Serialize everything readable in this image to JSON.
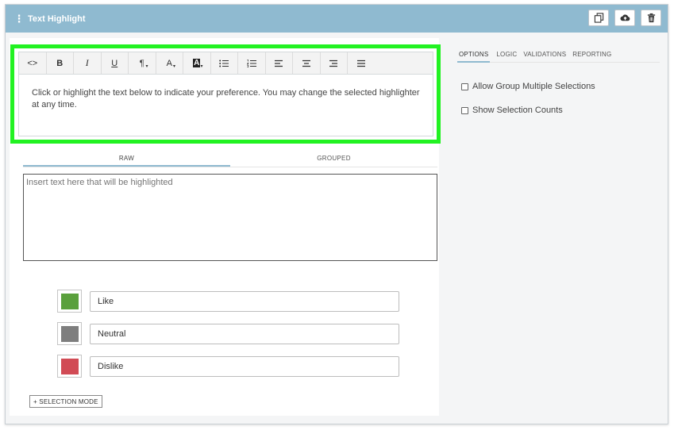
{
  "titlebar": {
    "title": "Text Highlight",
    "drag_glyph": "⋮",
    "actions": [
      "copy-icon",
      "cloud-upload-icon",
      "trash-icon"
    ]
  },
  "editor": {
    "toolbar": {
      "code": "<>",
      "bold": "B",
      "italic": "I",
      "underline": "U",
      "paragraph": "¶",
      "font_color": "A",
      "bg_color": "A",
      "caret": "▾"
    },
    "content": "Click or highlight the text below to indicate your preference. You may change the selected highlighter at any time."
  },
  "text_tabs": [
    "RAW",
    "GROUPED"
  ],
  "textarea": {
    "placeholder": "Insert text here that will be highlighted"
  },
  "highlighters": [
    {
      "label": "Like",
      "color": "#5aa03c"
    },
    {
      "label": "Neutral",
      "color": "#7e7e7e"
    },
    {
      "label": "Dislike",
      "color": "#d14b55"
    }
  ],
  "selection_mode_button": "+ SELECTION MODE",
  "options_panel": {
    "tabs": [
      "OPTIONS",
      "LOGIC",
      "VALIDATIONS",
      "REPORTING"
    ],
    "checkboxes": [
      "Allow Group Multiple Selections",
      "Show Selection Counts"
    ]
  },
  "colors": {
    "header": "#8fbad0",
    "highlight_outline": "#22f222"
  }
}
